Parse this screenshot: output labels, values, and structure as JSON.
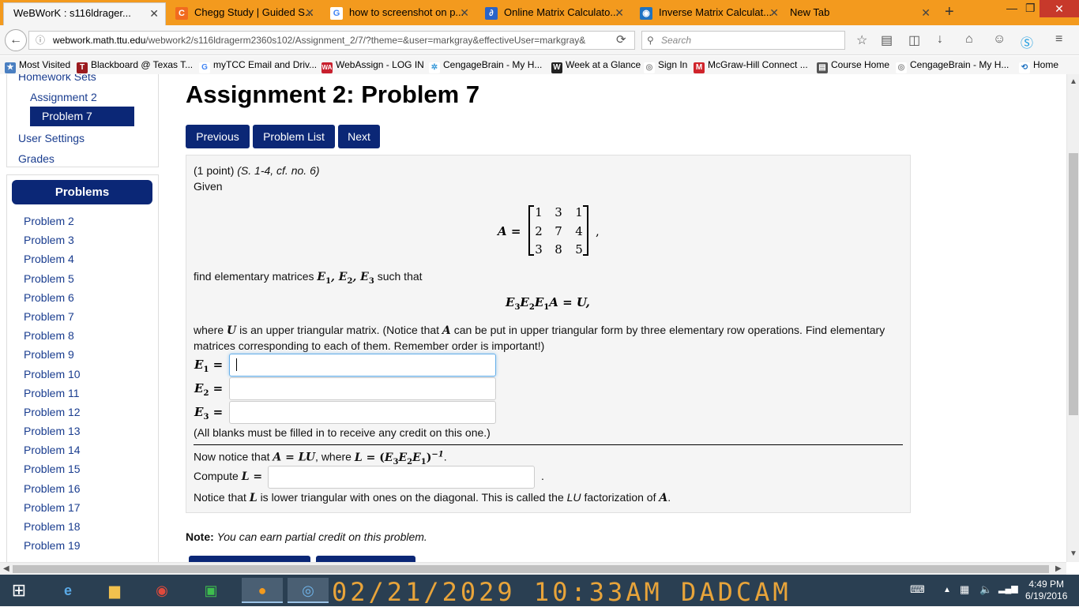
{
  "browser": {
    "tabs": [
      {
        "label": "WeBWorK : s116ldrager...",
        "icon_text": "",
        "icon_color": "#ffffff",
        "active": true
      },
      {
        "label": "Chegg Study | Guided S...",
        "icon_text": "C",
        "icon_color": "#f16b1f",
        "active": false
      },
      {
        "label": "how to screenshot on p...",
        "icon_text": "G",
        "icon_color": "#4285f4",
        "active": false
      },
      {
        "label": "Online Matrix Calculato...",
        "icon_text": "∂",
        "icon_color": "#2a64c8",
        "active": false
      },
      {
        "label": "Inverse Matrix Calculat...",
        "icon_text": "◉",
        "icon_color": "#1f73c2",
        "active": false
      },
      {
        "label": "New Tab",
        "icon_text": "",
        "icon_color": "#f39a1e",
        "active": false
      }
    ],
    "url_domain": "webwork.math.ttu.edu",
    "url_rest": "/webwork2/s116ldragerm2360s102/Assignment_2/7/?theme=&user=markgray&effectiveUser=markgray&",
    "search_placeholder": "Search",
    "bookmarks": [
      {
        "label": "Most Visited",
        "icon_text": "★",
        "icon_color": "#4a7fc1"
      },
      {
        "label": "Blackboard @ Texas T...",
        "icon_text": "T",
        "icon_color": "#9b1b1f"
      },
      {
        "label": "myTCC Email and Driv...",
        "icon_text": "G",
        "icon_color": "#4285f4"
      },
      {
        "label": "WebAssign - LOG IN",
        "icon_text": "WA",
        "icon_color": "#c8202e"
      },
      {
        "label": "CengageBrain - My H...",
        "icon_text": "✲",
        "icon_color": "#3a9ad9"
      },
      {
        "label": "Week at a Glance",
        "icon_text": "W",
        "icon_color": "#222222"
      },
      {
        "label": "Sign In",
        "icon_text": "◎",
        "icon_color": "#888888"
      },
      {
        "label": "McGraw-Hill Connect ...",
        "icon_text": "M",
        "icon_color": "#d0242b"
      },
      {
        "label": "Course Home",
        "icon_text": "▤",
        "icon_color": "#555555"
      },
      {
        "label": "CengageBrain - My H...",
        "icon_text": "◎",
        "icon_color": "#888888"
      },
      {
        "label": "Home",
        "icon_text": "⟲",
        "icon_color": "#1f73c2"
      }
    ]
  },
  "sidebar": {
    "homework_sets": "Homework Sets",
    "assignment": "Assignment 2",
    "active_problem": "Problem 7",
    "user_settings": "User Settings",
    "grades": "Grades",
    "problems_heading": "Problems",
    "problems": [
      "Problem 2",
      "Problem 3",
      "Problem 4",
      "Problem 5",
      "Problem 6",
      "Problem 7",
      "Problem 8",
      "Problem 9",
      "Problem 10",
      "Problem 11",
      "Problem 12",
      "Problem 13",
      "Problem 14",
      "Problem 15",
      "Problem 16",
      "Problem 17",
      "Problem 18",
      "Problem 19"
    ]
  },
  "main": {
    "title": "Assignment 2: Problem 7",
    "buttons": {
      "previous": "Previous",
      "problem_list": "Problem List",
      "next": "Next"
    },
    "problem": {
      "points": "(1 point)",
      "source": "(S. 1-4, cf. no. 6)",
      "given": "Given",
      "matrix_name": "A =",
      "matrix": [
        [
          "1",
          "3",
          "1"
        ],
        [
          "2",
          "7",
          "4"
        ],
        [
          "3",
          "8",
          "5"
        ]
      ],
      "find_prefix": "find elementary matrices",
      "find_suffix": "such that",
      "where_text_1": "where",
      "where_text_2": "is an upper triangular matrix. (Notice that",
      "where_text_3": "can be put in upper triangular form by three elementary row operations. Find elementary",
      "where_line_2": "matrices corresponding to each of them. Remember order is important!)",
      "e1_value": "",
      "e2_value": "",
      "e3_value": "",
      "blanks_note": "(All blanks must be filled in to receive any credit on this one.)",
      "now_notice": "Now notice that",
      "now_where": ", where",
      "compute": "Compute",
      "l_value": "",
      "final_1": "Notice that",
      "final_2": "is lower triangular with ones on the diagonal. This is called the",
      "final_lu": "LU",
      "final_3": "factorization of"
    },
    "note_label": "Note:",
    "note_text": "You can earn partial credit on this problem."
  },
  "taskbar": {
    "date_stamp": "02/21/2029 10:33AM DADCAM",
    "time": "4:49 PM",
    "date": "6/19/2016"
  }
}
